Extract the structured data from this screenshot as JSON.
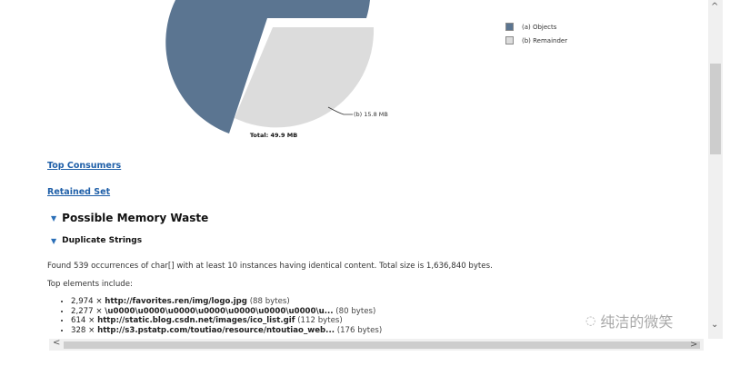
{
  "chart_data": {
    "type": "pie",
    "slices": [
      {
        "label": "(a) Objects",
        "color": "#5b7591"
      },
      {
        "label": "(b) Remainder",
        "value_label": "(b) 15.8 MB",
        "color": "#dcdcdc"
      }
    ],
    "total_label": "Total: 49.9 MB",
    "legend_placement": "right"
  },
  "links": {
    "top_consumers": "Top Consumers",
    "retained_set": "Retained Set"
  },
  "section": {
    "title": "Possible Memory Waste",
    "subsection": "Duplicate Strings",
    "summary": "Found 539 occurrences of char[] with at least 10 instances having identical content. Total size is 1,636,840 bytes.",
    "top_label": "Top elements include:",
    "items": [
      {
        "count": "2,974 ×",
        "text": "http://favorites.ren/img/logo.jpg",
        "size": "(88 bytes)"
      },
      {
        "count": "2,277 ×",
        "text": "\\u0000\\u0000\\u0000\\u0000\\u0000\\u0000\\u0000\\u...",
        "size": "(80 bytes)"
      },
      {
        "count": "614 ×",
        "text": "http://static.blog.csdn.net/images/ico_list.gif",
        "size": "(112 bytes)"
      },
      {
        "count": "328 ×",
        "text": "http://s3.pstatp.com/toutiao/resource/ntoutiao_web...",
        "size": "(176 bytes)"
      }
    ]
  },
  "watermark": {
    "text": "纯洁的微笑",
    "icon": "wechat-icon"
  }
}
